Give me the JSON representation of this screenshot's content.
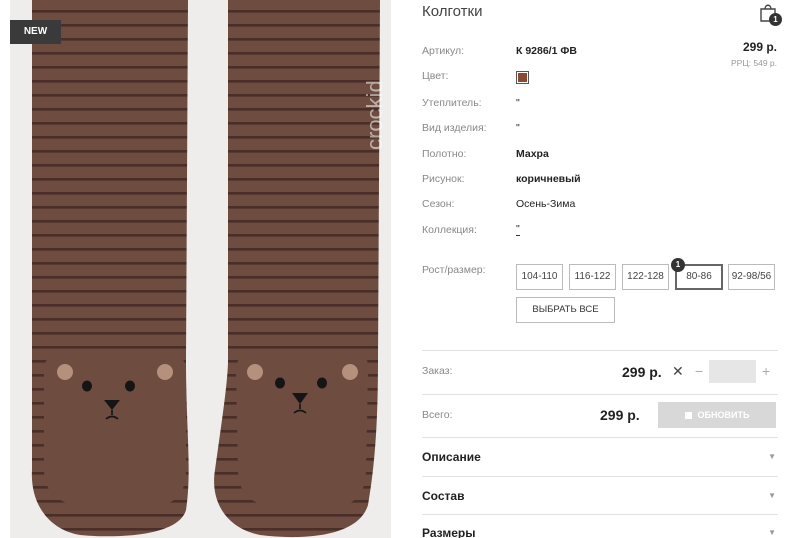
{
  "image": {
    "badge": "NEW",
    "watermark": "crockid",
    "accent_color": "#6e4c40"
  },
  "product": {
    "title": "Колготки",
    "price": "299 р.",
    "rrp": "РРЦ: 549 р.",
    "cart_count": "1"
  },
  "attributes": [
    {
      "label": "Артикул:",
      "value": "К 9286/1 ФВ"
    },
    {
      "label": "Цвет:",
      "value": "",
      "color": "#8a4a32"
    },
    {
      "label": "Утеплитель:",
      "value": "\""
    },
    {
      "label": "Вид изделия:",
      "value": "\""
    },
    {
      "label": "Полотно:",
      "value": "Махра"
    },
    {
      "label": "Рисунок:",
      "value": "коричневый"
    },
    {
      "label": "Сезон:",
      "value": "Осень-Зима"
    },
    {
      "label": "Коллекция:",
      "value": "\""
    }
  ],
  "sizes": {
    "label": "Рост/размер:",
    "options": [
      "104-110",
      "116-122",
      "122-128",
      "80-86",
      "92-98/56"
    ],
    "selected": "80-86",
    "selected_count": "1",
    "select_all_label": "ВЫБРАТЬ ВСЕ"
  },
  "order": {
    "label": "Заказ:",
    "price": "299 р.",
    "times": "✕",
    "minus": "−",
    "plus": "+",
    "quantity": ""
  },
  "total": {
    "label": "Всего:",
    "price": "299 р.",
    "update_label": "ОБНОВИТЬ"
  },
  "accordion": [
    {
      "title": "Описание"
    },
    {
      "title": "Состав"
    },
    {
      "title": "Размеры"
    }
  ]
}
